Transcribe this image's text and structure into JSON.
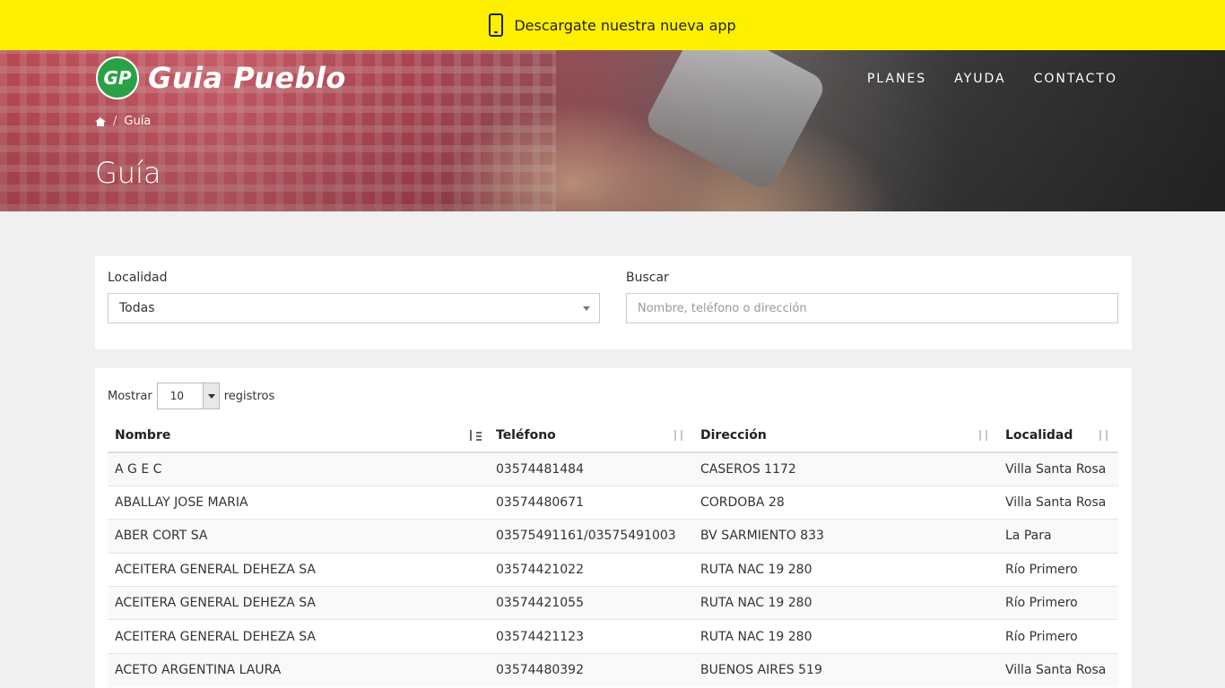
{
  "app_banner": {
    "text": "Descargate nuestra nueva app",
    "icon": "mobile-phone-icon"
  },
  "brand": {
    "badge": "GP",
    "name": "Guia Pueblo"
  },
  "nav": {
    "items": [
      "PLANES",
      "AYUDA",
      "CONTACTO"
    ]
  },
  "breadcrumb": {
    "home_icon": "home-icon",
    "separator": "/",
    "current": "Guía"
  },
  "page": {
    "title": "Guía"
  },
  "filters": {
    "localidad_label": "Localidad",
    "localidad_value": "Todas",
    "buscar_label": "Buscar",
    "buscar_placeholder": "Nombre, teléfono o dirección",
    "buscar_value": ""
  },
  "table": {
    "length_prefix": "Mostrar",
    "length_value": "10",
    "length_suffix": "registros",
    "columns": [
      "Nombre",
      "Teléfono",
      "Dirección",
      "Localidad"
    ],
    "rows": [
      [
        "A G E C",
        "03574481484",
        "CASEROS 1172",
        "Villa Santa Rosa"
      ],
      [
        "ABALLAY JOSE MARIA",
        "03574480671",
        "CORDOBA 28",
        "Villa Santa Rosa"
      ],
      [
        "ABER CORT SA",
        "03575491161/03575491003",
        "BV SARMIENTO 833",
        "La Para"
      ],
      [
        "ACEITERA GENERAL DEHEZA SA",
        "03574421022",
        "RUTA NAC 19 280",
        "Río Primero"
      ],
      [
        "ACEITERA GENERAL DEHEZA SA",
        "03574421055",
        "RUTA NAC 19 280",
        "Río Primero"
      ],
      [
        "ACEITERA GENERAL DEHEZA SA",
        "03574421123",
        "RUTA NAC 19 280",
        "Río Primero"
      ],
      [
        "ACETO ARGENTINA LAURA",
        "03574480392",
        "BUENOS AIRES 519",
        "Villa Santa Rosa"
      ]
    ]
  },
  "colors": {
    "banner": "#fff000",
    "logo_green": "#2aa146"
  }
}
